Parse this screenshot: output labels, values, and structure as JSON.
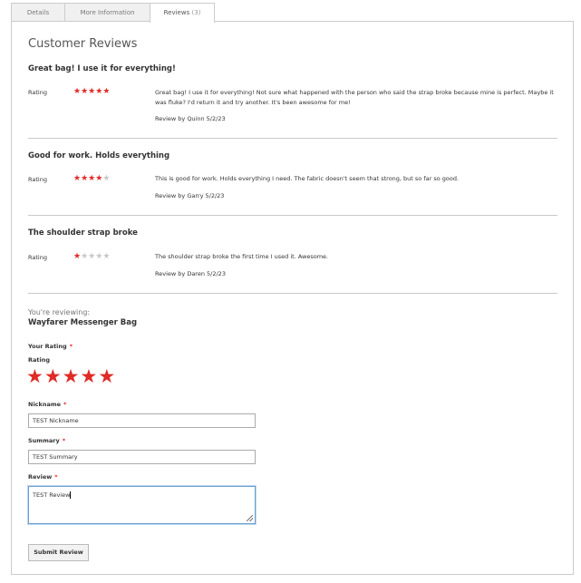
{
  "tabs": [
    {
      "label": "Details",
      "count": ""
    },
    {
      "label": "More Information",
      "count": ""
    },
    {
      "label": "Reviews",
      "count": "(3)"
    }
  ],
  "section_title": "Customer Reviews",
  "rating_label": "Rating",
  "reviews": [
    {
      "title": "Great bag! I use it for everything!",
      "rating": 5,
      "content": "Great bag! I use it for everything! Not sure what happened with the person who said the strap broke because mine is perfect. Maybe it was fluke? I'd return it and try another. It's been awesome for me!",
      "by_label": "Review by",
      "author": "Quinn",
      "date": "5/2/23"
    },
    {
      "title": "Good for work. Holds everything",
      "rating": 4,
      "content": "This is good for work. Holds everything I need. The fabric doesn't seem that strong, but so far so good.",
      "by_label": "Review by",
      "author": "Garry",
      "date": "5/2/23"
    },
    {
      "title": "The shoulder strap broke",
      "rating": 1,
      "content": "The shoulder strap broke the first time I used it. Awesome.",
      "by_label": "Review by",
      "author": "Daren",
      "date": "5/2/23"
    }
  ],
  "form": {
    "reviewing_label": "You're reviewing:",
    "product_name": "Wayfarer Messenger Bag",
    "your_rating_label": "Your Rating",
    "rating_label": "Rating",
    "rating_selected": 5,
    "nickname_label": "Nickname",
    "nickname_value": "TEST Nickname",
    "summary_label": "Summary",
    "summary_value": "TEST Summary",
    "review_label": "Review",
    "review_value": "TEST Review",
    "required_mark": "*",
    "submit_label": "Submit Review"
  },
  "colors": {
    "star_on": "#e02b27",
    "star_off": "#c8c8c8",
    "required": "#e02b27"
  }
}
